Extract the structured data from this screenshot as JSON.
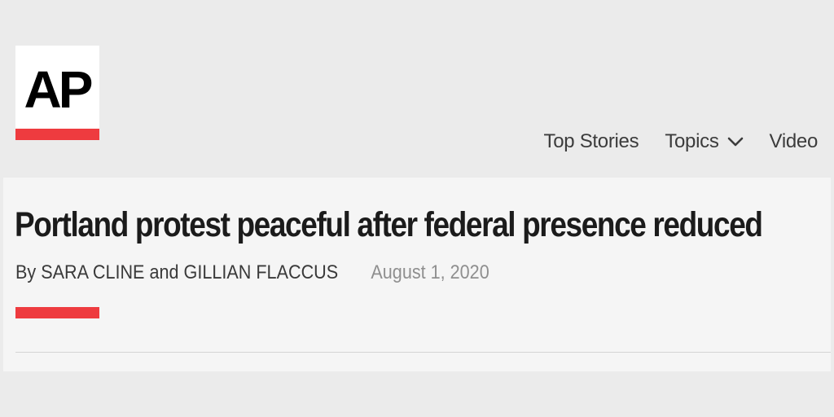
{
  "logo": {
    "text": "AP",
    "accent_color": "#ee3b3f"
  },
  "nav": {
    "items": [
      {
        "label": "Top Stories"
      },
      {
        "label": "Topics",
        "icon": "chevron-down-icon"
      },
      {
        "label": "Video"
      }
    ]
  },
  "article": {
    "headline": "Portland protest peaceful after federal presence reduced",
    "byline_prefix": "By",
    "author_1": "SARA CLINE",
    "author_joiner": "and",
    "author_2": "GILLIAN FLACCUS",
    "date": "August 1, 2020"
  },
  "colors": {
    "page_background": "#ebebeb",
    "article_background": "#f5f5f5",
    "accent": "#ee3b3f",
    "headline_text": "#1b1b1b",
    "date_text": "#8f8f8f"
  }
}
